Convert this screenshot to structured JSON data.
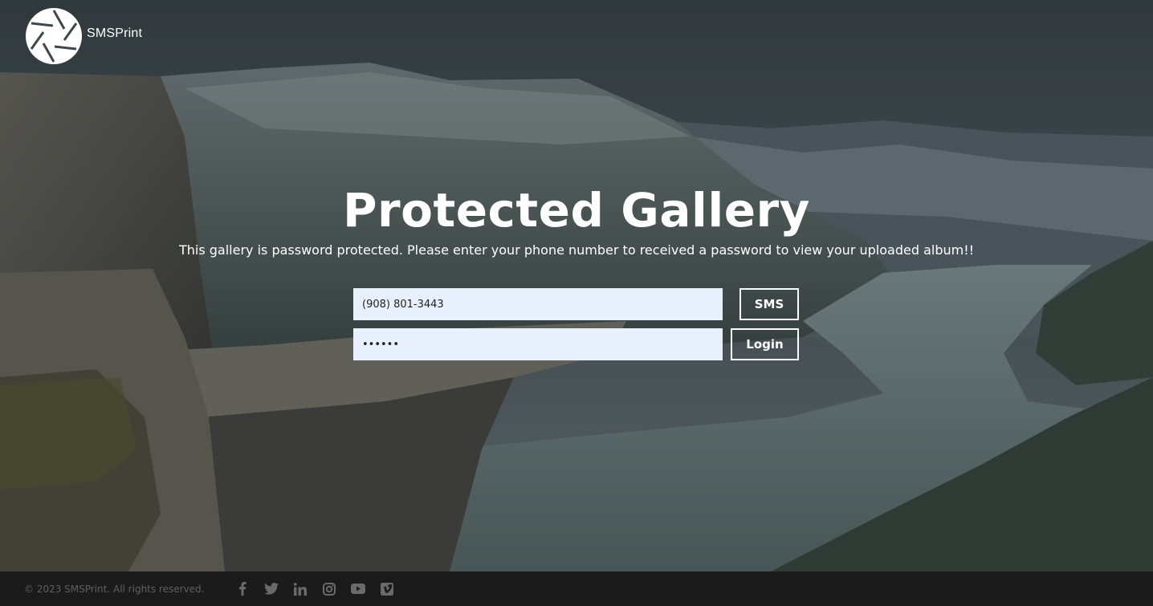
{
  "brand": {
    "name": "SMSPrint",
    "logo_icon": "camera-aperture-icon"
  },
  "hero": {
    "title": "Protected Gallery",
    "subtitle": "This gallery is password protected. Please enter your phone number to received a password to view your uploaded album!!"
  },
  "form": {
    "phone_value": "(908) 801-3443",
    "password_value": "aaaaaa",
    "sms_label": "SMS",
    "login_label": "Login"
  },
  "footer": {
    "copyright": "© 2023 SMSPrint. All rights reserved.",
    "social": [
      {
        "name": "facebook-icon"
      },
      {
        "name": "twitter-icon"
      },
      {
        "name": "linkedin-icon"
      },
      {
        "name": "instagram-icon"
      },
      {
        "name": "youtube-icon"
      },
      {
        "name": "vimeo-icon"
      }
    ]
  },
  "colors": {
    "input_background": "#e8f0fe",
    "footer_background": "#1b1b1b",
    "footer_text": "#5f5f5f",
    "text": "#ffffff"
  }
}
